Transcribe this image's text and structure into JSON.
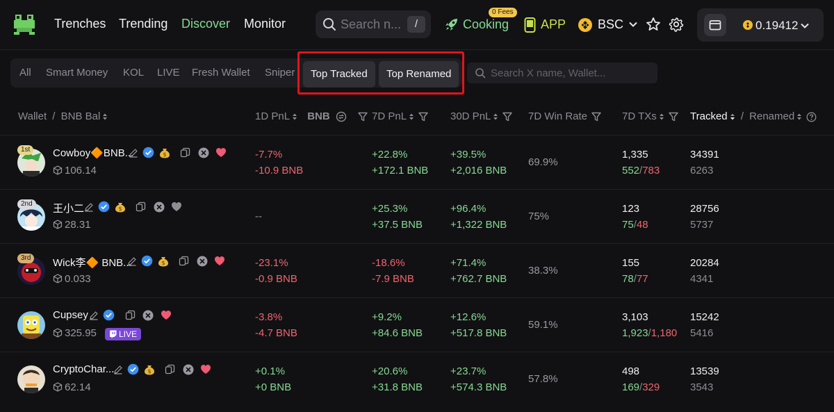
{
  "nav": {
    "links": [
      "Trenches",
      "Trending",
      "Discover",
      "Monitor"
    ],
    "active": "Discover",
    "search_placeholder": "Search n...",
    "search_shortcut": "/",
    "cooking_label": "Cooking",
    "fees_badge": "0 Fees",
    "app_label": "APP",
    "chain_label": "BSC",
    "balance": "0.19412"
  },
  "filters": {
    "tabs": [
      "All",
      "Smart Money",
      "KOL",
      "LIVE",
      "Fresh Wallet",
      "Sniper"
    ],
    "pill_tabs": [
      "Top Tracked",
      "Top Renamed"
    ],
    "search_placeholder": "Search X name, Wallet..."
  },
  "columns": {
    "wallet": "Wallet",
    "sep": "/",
    "bnb_bal": "BNB Bal",
    "pnl_1d": "1D PnL",
    "bnb": "BNB",
    "pnl_7d": "7D PnL",
    "pnl_30d": "30D PnL",
    "win_rate": "7D Win Rate",
    "txs_7d": "7D TXs",
    "tracked": "Tracked",
    "renamed": "Renamed"
  },
  "colors": {
    "accent_green": "#86d993",
    "loss_red": "#f0646e",
    "highlight": "#e3141c",
    "live_purple": "#7a48d8"
  },
  "rows": [
    {
      "rank": "1st",
      "name": "Cowboy🔶BNB...",
      "bal": "106.14",
      "heart": "red",
      "money": true,
      "pnl1d_pct": "-7.7%",
      "pnl1d_bnb": "-10.9 BNB",
      "pnl1d_dir": "red",
      "pnl7d_pct": "+22.8%",
      "pnl7d_bnb": "+172.1 BNB",
      "pnl7d_dir": "green",
      "pnl30d_pct": "+39.5%",
      "pnl30d_bnb": "+2,016 BNB",
      "pnl30d_dir": "green",
      "win_rate": "69.9%",
      "txs": "1,335",
      "buys": "552",
      "sells": "783",
      "tracked": "34391",
      "renamed": "6263"
    },
    {
      "rank": "2nd",
      "name": "王小二",
      "bal": "28.31",
      "heart": "grey",
      "money": true,
      "pnl1d_pct": "--",
      "pnl1d_bnb": "",
      "pnl1d_dir": "grey",
      "pnl7d_pct": "+25.3%",
      "pnl7d_bnb": "+37.5 BNB",
      "pnl7d_dir": "green",
      "pnl30d_pct": "+96.4%",
      "pnl30d_bnb": "+1,322 BNB",
      "pnl30d_dir": "green",
      "win_rate": "75%",
      "txs": "123",
      "buys": "75",
      "sells": "48",
      "tracked": "28756",
      "renamed": "5737"
    },
    {
      "rank": "3rd",
      "name": "Wick李🔶 BNB...",
      "bal": "0.033",
      "heart": "red",
      "money": true,
      "pnl1d_pct": "-23.1%",
      "pnl1d_bnb": "-0.9 BNB",
      "pnl1d_dir": "red",
      "pnl7d_pct": "-18.6%",
      "pnl7d_bnb": "-7.9 BNB",
      "pnl7d_dir": "red",
      "pnl30d_pct": "+71.4%",
      "pnl30d_bnb": "+762.7 BNB",
      "pnl30d_dir": "green",
      "win_rate": "38.3%",
      "txs": "155",
      "buys": "78",
      "sells": "77",
      "tracked": "20284",
      "renamed": "4341"
    },
    {
      "rank": "",
      "name": "Cupsey",
      "bal": "325.95",
      "heart": "red",
      "money": false,
      "live": "LIVE",
      "pnl1d_pct": "-3.8%",
      "pnl1d_bnb": "-4.7 BNB",
      "pnl1d_dir": "red",
      "pnl7d_pct": "+9.2%",
      "pnl7d_bnb": "+84.6 BNB",
      "pnl7d_dir": "green",
      "pnl30d_pct": "+12.6%",
      "pnl30d_bnb": "+517.8 BNB",
      "pnl30d_dir": "green",
      "win_rate": "59.1%",
      "txs": "3,103",
      "buys": "1,923",
      "sells": "1,180",
      "tracked": "15242",
      "renamed": "5416"
    },
    {
      "rank": "",
      "name": "CryptoChar...",
      "bal": "62.14",
      "heart": "red",
      "money": true,
      "pnl1d_pct": "+0.1%",
      "pnl1d_bnb": "+0 BNB",
      "pnl1d_dir": "green",
      "pnl7d_pct": "+20.6%",
      "pnl7d_bnb": "+31.8 BNB",
      "pnl7d_dir": "green",
      "pnl30d_pct": "+23.7%",
      "pnl30d_bnb": "+574.3 BNB",
      "pnl30d_dir": "green",
      "win_rate": "57.8%",
      "txs": "498",
      "buys": "169",
      "sells": "329",
      "tracked": "13539",
      "renamed": "3543"
    }
  ]
}
